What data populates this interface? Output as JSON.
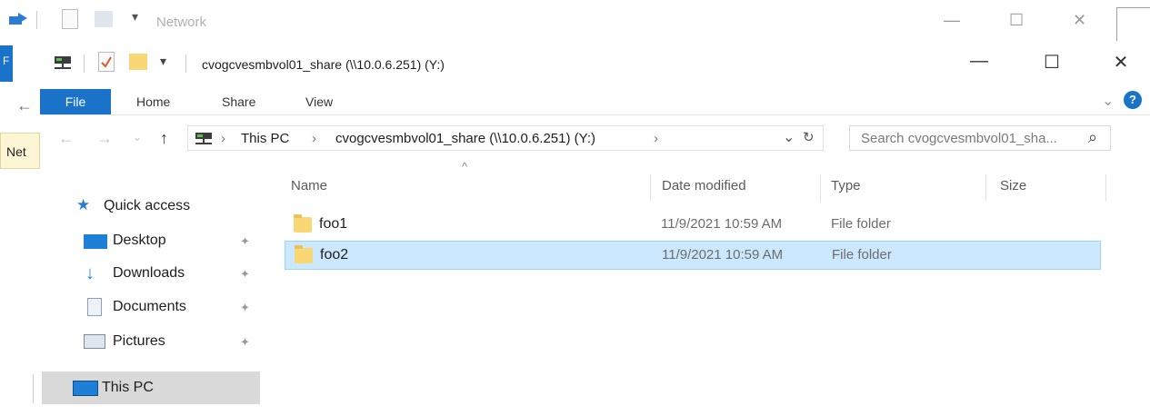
{
  "background_window": {
    "title": "Network",
    "file_tab_letter": "F",
    "nav_label": "Net",
    "controls": {
      "minimize": "—",
      "maximize": "☐",
      "close": "✕"
    }
  },
  "window": {
    "title": "cvogcvesmbvol01_share (\\\\10.0.6.251) (Y:)",
    "controls": {
      "minimize": "—",
      "maximize": "☐",
      "close": "✕"
    }
  },
  "ribbon": {
    "tabs": [
      "File",
      "Home",
      "Share",
      "View"
    ],
    "collapse_glyph": "⌄",
    "help_glyph": "?"
  },
  "address": {
    "crumbs": [
      "This PC",
      "cvogcvesmbvol01_share (\\\\10.0.6.251) (Y:)"
    ],
    "separator": "›",
    "dropdown_glyph": "⌄",
    "refresh_glyph": "↻",
    "search_placeholder": "Search cvogcvesmbvol01_sha...",
    "search_glyph": "⌕"
  },
  "nav_buttons": {
    "back": "←",
    "forward": "→",
    "recent": "⌄",
    "up": "↑"
  },
  "nav_pane": {
    "quick_access": "Quick access",
    "items": [
      {
        "label": "Desktop",
        "icon": "desktop-icon",
        "pinned": true
      },
      {
        "label": "Downloads",
        "icon": "downloads-icon",
        "pinned": true
      },
      {
        "label": "Documents",
        "icon": "documents-icon",
        "pinned": true
      },
      {
        "label": "Pictures",
        "icon": "pictures-icon",
        "pinned": true
      }
    ],
    "this_pc": "This PC",
    "pin_glyph": "✦"
  },
  "columns": {
    "name": "Name",
    "date": "Date modified",
    "type": "Type",
    "size": "Size",
    "sort_glyph": "^"
  },
  "files": [
    {
      "name": "foo1",
      "date": "11/9/2021 10:59 AM",
      "type": "File folder",
      "selected": false
    },
    {
      "name": "foo2",
      "date": "11/9/2021 10:59 AM",
      "type": "File folder",
      "selected": true
    }
  ],
  "colors": {
    "accent": "#1a73c9",
    "selection": "#cce8ff",
    "folder": "#f8d774"
  }
}
